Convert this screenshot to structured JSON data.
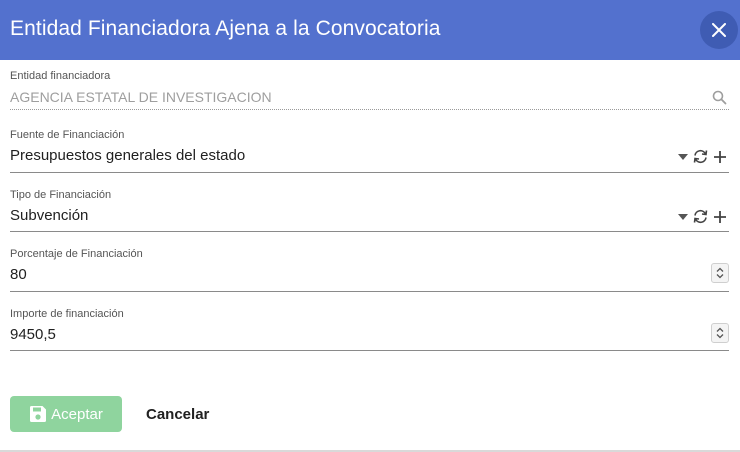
{
  "dialog": {
    "title": "Entidad Financiadora Ajena a la Convocatoria"
  },
  "fields": {
    "entidad": {
      "label": "Entidad financiadora",
      "value": "AGENCIA ESTATAL DE INVESTIGACION"
    },
    "fuente": {
      "label": "Fuente de Financiación",
      "value": "Presupuestos generales del estado"
    },
    "tipo": {
      "label": "Tipo de Financiación",
      "value": "Subvención"
    },
    "porcentaje": {
      "label": "Porcentaje de Financiación",
      "value": "80"
    },
    "importe": {
      "label": "Importe de financiación",
      "value": "9450,5"
    }
  },
  "actions": {
    "accept_label": "Aceptar",
    "cancel_label": "Cancelar"
  },
  "colors": {
    "header": "#5371ce",
    "accept_button": "#8fd49e"
  },
  "icons": [
    "close-icon",
    "search-icon",
    "dropdown-arrow-icon",
    "refresh-icon",
    "add-icon",
    "stepper-icon",
    "save-icon"
  ]
}
